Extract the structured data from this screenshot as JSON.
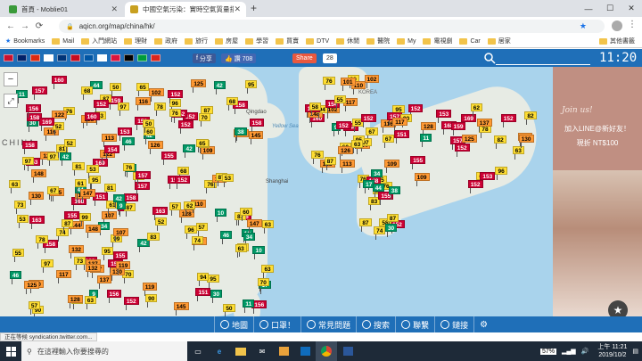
{
  "browser": {
    "tabs": [
      {
        "title": "首頁 - Moblie01",
        "favicon_color": "#3a9a3a"
      },
      {
        "title": "中國空氣污染：實時空氣質量指數",
        "favicon_color": "#c8a020"
      }
    ],
    "url": "aqicn.org/map/china/hk/",
    "bookmarks": [
      {
        "label": "Bookmarks",
        "type": "star"
      },
      {
        "label": "Mail",
        "type": "folder"
      },
      {
        "label": "入門網站",
        "type": "folder"
      },
      {
        "label": "理財",
        "type": "folder"
      },
      {
        "label": "政府",
        "type": "folder"
      },
      {
        "label": "旅行",
        "type": "folder"
      },
      {
        "label": "房屋",
        "type": "folder"
      },
      {
        "label": "學習",
        "type": "folder"
      },
      {
        "label": "買賣",
        "type": "folder"
      },
      {
        "label": "DTV",
        "type": "folder"
      },
      {
        "label": "休閒",
        "type": "folder"
      },
      {
        "label": "醫院",
        "type": "folder"
      },
      {
        "label": "My",
        "type": "folder"
      },
      {
        "label": "電視劇",
        "type": "folder"
      },
      {
        "label": "Car",
        "type": "folder"
      },
      {
        "label": "居家",
        "type": "folder"
      },
      {
        "label": "其他書籤",
        "type": "folder"
      }
    ],
    "status_text": "正在等候 syndication.twitter.com..."
  },
  "site": {
    "fb_share": "分享",
    "fb_like": "讚 708",
    "share_label": "Share",
    "share_count": "28",
    "clock": "11:20",
    "flag_colors": [
      "#c8102e",
      "#012169",
      "#de2910",
      "#ffffff",
      "#003478",
      "#c60b1e",
      "#0055a4",
      "#ffffff",
      "#dc143c",
      "#000000",
      "#009c3b",
      "#da251d"
    ]
  },
  "map": {
    "sea_labels": [
      "Yellow Sea",
      "KOREA",
      "Qingdao",
      "Shanghai",
      "CHINA"
    ],
    "markers": [
      {
        "v": "78",
        "c": "#ffde33"
      },
      {
        "v": "158",
        "c": "#cc0033"
      },
      {
        "v": "155",
        "c": "#cc0033"
      },
      {
        "v": "163",
        "c": "#cc0033"
      },
      {
        "v": "130",
        "c": "#ff9933"
      },
      {
        "v": "152",
        "c": "#cc0033"
      },
      {
        "v": "159",
        "c": "#cc0033"
      },
      {
        "v": "156",
        "c": "#cc0033"
      },
      {
        "v": "152",
        "c": "#cc0033"
      },
      {
        "v": "153",
        "c": "#cc0033"
      },
      {
        "v": "128",
        "c": "#ff9933"
      },
      {
        "v": "97",
        "c": "#ffde33"
      },
      {
        "v": "63",
        "c": "#ffde33"
      },
      {
        "v": "102",
        "c": "#ff9933"
      },
      {
        "v": "145",
        "c": "#ff9933"
      },
      {
        "v": "168",
        "c": "#cc0033"
      },
      {
        "v": "155",
        "c": "#cc0033"
      },
      {
        "v": "116",
        "c": "#ff9933"
      },
      {
        "v": "157",
        "c": "#cc0033"
      },
      {
        "v": "96",
        "c": "#ffde33"
      },
      {
        "v": "83",
        "c": "#ffde33"
      },
      {
        "v": "70",
        "c": "#ffde33"
      },
      {
        "v": "46",
        "c": "#009966"
      },
      {
        "v": "87",
        "c": "#ffde33"
      },
      {
        "v": "95",
        "c": "#ffde33"
      },
      {
        "v": "152",
        "c": "#cc0033"
      },
      {
        "v": "154",
        "c": "#cc0033"
      },
      {
        "v": "169",
        "c": "#cc0033"
      },
      {
        "v": "99",
        "c": "#ffde33"
      },
      {
        "v": "128",
        "c": "#ff9933"
      },
      {
        "v": "107",
        "c": "#ff9933"
      },
      {
        "v": "90",
        "c": "#ffde33"
      },
      {
        "v": "87",
        "c": "#ffde33"
      },
      {
        "v": "97",
        "c": "#ffde33"
      },
      {
        "v": "152",
        "c": "#cc0033"
      },
      {
        "v": "117",
        "c": "#ff9933"
      },
      {
        "v": "119",
        "c": "#ff9933"
      },
      {
        "v": "95",
        "c": "#ffde33"
      },
      {
        "v": "73",
        "c": "#ffde33"
      },
      {
        "v": "152",
        "c": "#cc0033"
      },
      {
        "v": "158",
        "c": "#cc0033"
      },
      {
        "v": "153",
        "c": "#cc0033"
      },
      {
        "v": "137",
        "c": "#ff9933"
      },
      {
        "v": "160",
        "c": "#cc0033"
      },
      {
        "v": "148",
        "c": "#ff9933"
      },
      {
        "v": "63",
        "c": "#ffde33"
      },
      {
        "v": "76",
        "c": "#ffde33"
      },
      {
        "v": "87",
        "c": "#ffde33"
      },
      {
        "v": "117",
        "c": "#ff9933"
      },
      {
        "v": "110",
        "c": "#ff9933"
      },
      {
        "v": "30",
        "c": "#009966"
      },
      {
        "v": "53",
        "c": "#ffde33"
      },
      {
        "v": "61",
        "c": "#ffde33"
      },
      {
        "v": "157",
        "c": "#cc0033"
      },
      {
        "v": "10",
        "c": "#009966"
      },
      {
        "v": "34",
        "c": "#009966"
      },
      {
        "v": "17",
        "c": "#009966"
      },
      {
        "v": "42",
        "c": "#009966"
      },
      {
        "v": "63",
        "c": "#ffde33"
      },
      {
        "v": "58",
        "c": "#ffde33"
      },
      {
        "v": "57",
        "c": "#ffde33"
      },
      {
        "v": "68",
        "c": "#ffde33"
      },
      {
        "v": "55",
        "c": "#ffde33"
      },
      {
        "v": "62",
        "c": "#ffde33"
      },
      {
        "v": "81",
        "c": "#ffde33"
      },
      {
        "v": "76",
        "c": "#ffde33"
      },
      {
        "v": "52",
        "c": "#ffde33"
      },
      {
        "v": "44",
        "c": "#009966"
      },
      {
        "v": "65",
        "c": "#ffde33"
      },
      {
        "v": "74",
        "c": "#ffde33"
      },
      {
        "v": "109",
        "c": "#ff9933"
      },
      {
        "v": "125",
        "c": "#ff9933"
      },
      {
        "v": "151",
        "c": "#cc0033"
      },
      {
        "v": "60",
        "c": "#ffde33"
      },
      {
        "v": "38",
        "c": "#009966"
      },
      {
        "v": "42",
        "c": "#009966"
      },
      {
        "v": "11",
        "c": "#009966"
      },
      {
        "v": "9",
        "c": "#009966"
      },
      {
        "v": "67",
        "c": "#ffde33"
      },
      {
        "v": "50",
        "c": "#ffde33"
      },
      {
        "v": "94",
        "c": "#ffde33"
      },
      {
        "v": "126",
        "c": "#ff9933"
      },
      {
        "v": "132",
        "c": "#ff9933"
      },
      {
        "v": "144",
        "c": "#ff9933"
      },
      {
        "v": "101",
        "c": "#ff9933"
      },
      {
        "v": "82",
        "c": "#ffde33"
      },
      {
        "v": "76",
        "c": "#ffde33"
      },
      {
        "v": "113",
        "c": "#ff9933"
      },
      {
        "v": "122",
        "c": "#ff9933"
      },
      {
        "v": "147",
        "c": "#ff9933"
      }
    ]
  },
  "ad": {
    "script": "Join us!",
    "line1": "加入LINE@新好友！",
    "line2": "現折 NT$100"
  },
  "bottom_nav": [
    "地圖",
    "口罩！",
    "常見問題",
    "搜索",
    "聯繫",
    "鏈接"
  ],
  "taskbar": {
    "search_placeholder": "在這裡輸入你要搜尋的",
    "battery": "57%",
    "time": "上午 11:21",
    "date": "2019/10/2"
  }
}
